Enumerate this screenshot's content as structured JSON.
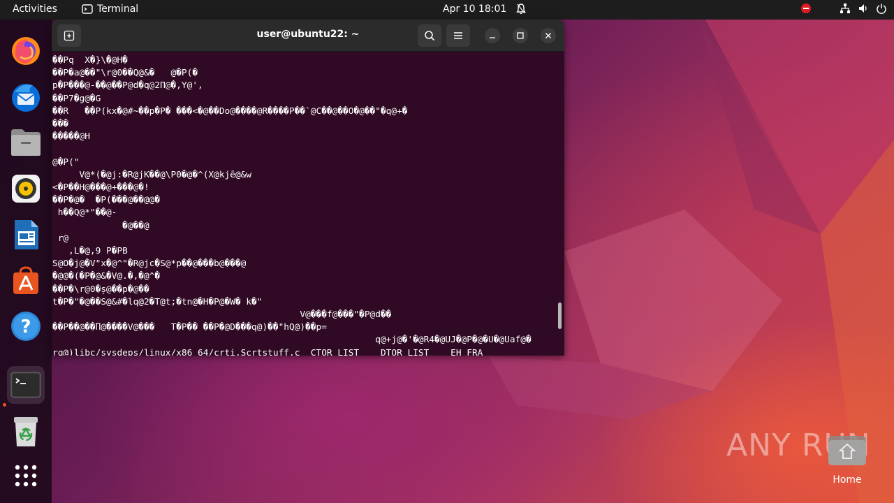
{
  "topbar": {
    "activities": "Activities",
    "app_name": "Terminal",
    "clock": "Apr 10  18:01"
  },
  "dock": {
    "items": [
      {
        "name": "firefox",
        "icon": "firefox-icon"
      },
      {
        "name": "thunderbird",
        "icon": "thunderbird-icon"
      },
      {
        "name": "files",
        "icon": "files-icon"
      },
      {
        "name": "rhythmbox",
        "icon": "rhythmbox-icon"
      },
      {
        "name": "libreoffice-writer",
        "icon": "writer-icon"
      },
      {
        "name": "app-center",
        "icon": "app-center-icon"
      },
      {
        "name": "help",
        "icon": "help-icon"
      },
      {
        "name": "terminal",
        "icon": "terminal-icon"
      },
      {
        "name": "trash",
        "icon": "trash-icon"
      },
      {
        "name": "show-apps",
        "icon": "app-grid-icon"
      }
    ]
  },
  "terminal": {
    "title": "user@ubuntu22: ~",
    "output": "��Pq  X�}\\�@H�\n��P�a@��\"\\r@0��Q@&�   @�P(�\np�P���@-��@��P@d�q@2П@�,Y@',\n��P7�g@�G\n��R   ��P(kx�@#~��p�P� ���<�@��Do@����@R����P��`@C��@��O�@��\"�q@+�\n���\n�����@H\n\n@�P(\"\n     V@*(�@j:�R@jK��@\\P0�@�^(X@kjē@&w\n<�P��H@���@+���@�!\n��P�@�  �P(���@��@@�\n h��Q@*\"��@-\n             �@��@\n r@\n   ,L�@,9 P�PB\nS@O�j@�V\"x�@^\"�R@jc�S@*p��@���b@���@\n�@@�(�P�@&�V@.�,�@^�\n��P�\\r@0�ș@��p�@��\nt�P�\"�@��S@&#�lq@2�T@t;�tn@�H�P@�W� k�\"\n                                              V@���f@���\"�P@d��\n��P��@��Π@����V@���   T�P�� ��P�@D���q@)��\"hQ@)��p=\n                                                            q@+j@�'�@R4�@UJ�@P�@�U�@Uaf@�\nrq@)libc/sysdeps/linux/x86_64/crti.Scrtstuff.c__CTOR_LIST____DTOR_LIST____EH_FRA"
  },
  "desktop": {
    "watermark": "ANY RUN",
    "home_label": "Home"
  },
  "colors": {
    "topbar": "#1d1d1d",
    "terminal_bg": "#300a24",
    "accent": "#e95420"
  }
}
